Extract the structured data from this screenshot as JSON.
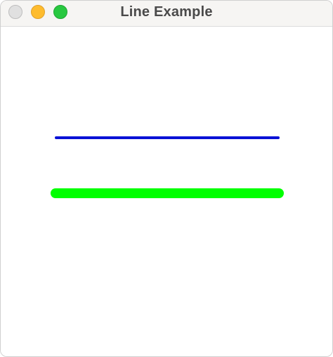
{
  "window": {
    "title": "Line Example",
    "controls": {
      "close_color": "#e0e0e0",
      "minimize_color": "#febc2e",
      "zoom_color": "#28c840"
    }
  },
  "canvas": {
    "lines": [
      {
        "name": "blue-line",
        "color": "#0a12d6"
      },
      {
        "name": "green-line",
        "color": "#00ff00"
      }
    ]
  }
}
